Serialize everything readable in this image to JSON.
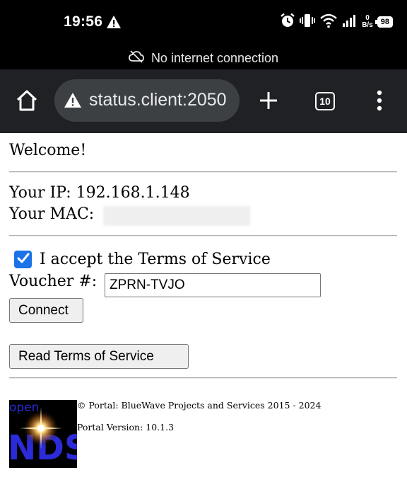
{
  "status_bar": {
    "time": "19:56",
    "net_speed_value": "0",
    "net_speed_unit": "B/s",
    "battery": "98"
  },
  "banner": {
    "text": "No internet connection"
  },
  "toolbar": {
    "url": "status.client:2050",
    "tab_count": "10"
  },
  "page": {
    "welcome": "Welcome!",
    "ip_line": "Your IP: 192.168.1.148",
    "mac_label": "Your MAC:",
    "tos_checkbox_checked": true,
    "tos_label": "I accept the Terms of Service",
    "voucher_label": "Voucher #:",
    "voucher_value": "ZPRN-TVJO",
    "connect_label": "Connect",
    "read_tos_label": "Read Terms of Service",
    "logo_text_top": "open",
    "logo_text_main": "NDS",
    "footer_copyright": "© Portal: BlueWave Projects and Services 2015 - 2024",
    "footer_version": "Portal Version: 10.1.3"
  },
  "colors": {
    "status_bar_bg": "#000000",
    "toolbar_bg": "#202124",
    "omnibox_bg": "#3c4043",
    "checkbox_accent": "#1a73e8"
  },
  "icons": {
    "status_warning": "warning-triangle-icon",
    "alarm": "alarm-icon",
    "vibrate": "vibrate-icon",
    "wifi": "wifi-icon",
    "signal": "cellular-signal-icon",
    "cloud_off": "cloud-off-icon",
    "home": "home-icon",
    "not_secure": "warning-triangle-icon",
    "new_tab": "plus-icon",
    "menu": "more-vert-icon"
  }
}
